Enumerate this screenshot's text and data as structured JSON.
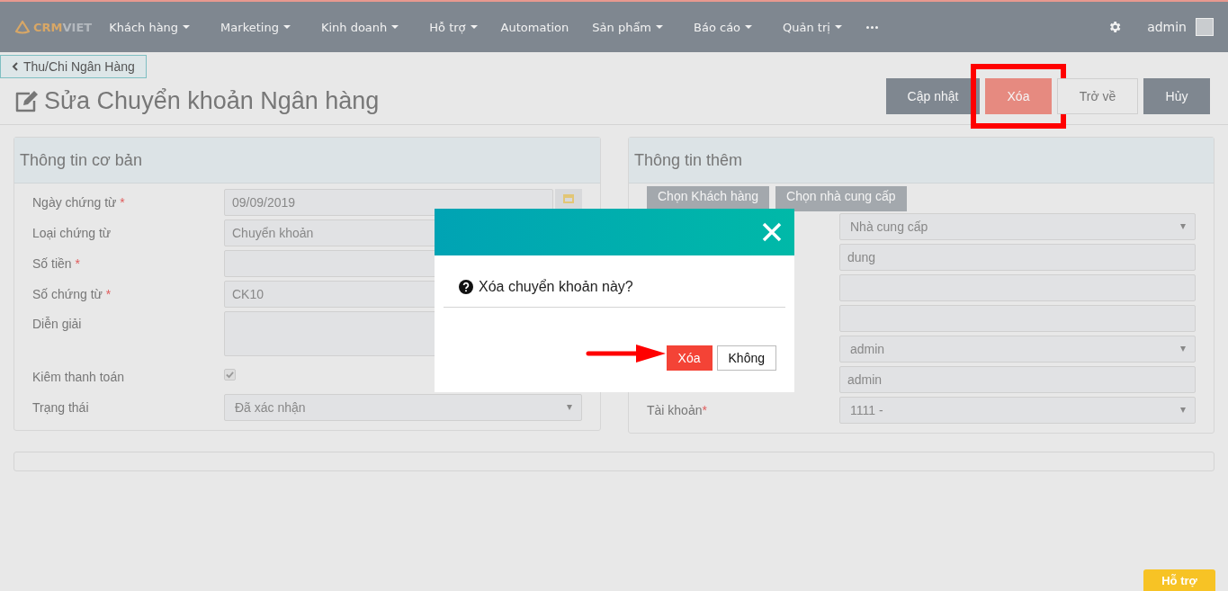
{
  "nav": {
    "logo": [
      "CRM",
      "VIET"
    ],
    "items": [
      {
        "label": "Khách hàng",
        "dropdown": true
      },
      {
        "label": "Marketing",
        "dropdown": true
      },
      {
        "label": "Kinh doanh",
        "dropdown": true
      },
      {
        "label": "Hỗ trợ",
        "dropdown": true
      },
      {
        "label": "Automation",
        "dropdown": false
      },
      {
        "label": "Sản phẩm",
        "dropdown": true
      },
      {
        "label": "Báo cáo",
        "dropdown": true
      },
      {
        "label": "Quản trị",
        "dropdown": true
      }
    ],
    "user": "admin"
  },
  "breadcrumb": "Thu/Chi Ngân Hàng",
  "title": "Sửa Chuyển khoản Ngân hàng",
  "actions": [
    {
      "label": "Cập nhật",
      "kind": "dark",
      "highlighted": false
    },
    {
      "label": "Xóa",
      "kind": "danger",
      "highlighted": true
    },
    {
      "label": "Trở về",
      "kind": "light",
      "highlighted": false
    },
    {
      "label": "Hủy",
      "kind": "dark",
      "highlighted": false
    }
  ],
  "basic": {
    "title": "Thông tin cơ bản",
    "fields": [
      {
        "label": "Ngày chứng từ",
        "required_mark": "*",
        "kind": "date",
        "value": "09/09/2019"
      },
      {
        "label": "Loại chứng từ",
        "kind": "input",
        "value": "Chuyển khoản"
      },
      {
        "label": "Số tiền",
        "required_mark": "*",
        "kind": "input"
      },
      {
        "label": "Số chứng từ",
        "required_mark": "*",
        "kind": "input",
        "value": "CK10"
      },
      {
        "label": "Diễn giải",
        "kind": "textarea"
      },
      {
        "label": "Kiêm thanh toán",
        "kind": "checkbox",
        "checked": true
      },
      {
        "label": "Trạng thái",
        "kind": "select",
        "value": "Đã xác nhận"
      }
    ]
  },
  "extra": {
    "title": "Thông tin thêm",
    "buttons": [
      "Chọn Khách hàng",
      "Chọn nhà cung cấp"
    ],
    "fields": [
      {
        "kind": "select",
        "value": "Nhà cung cấp"
      },
      {
        "kind": "input",
        "value": "dung"
      },
      {
        "kind": "input"
      },
      {
        "kind": "input"
      },
      {
        "kind": "select",
        "value": "admin"
      },
      {
        "kind": "input",
        "value": "admin"
      },
      {
        "label": "Tài khoản",
        "required_mark": "*",
        "kind": "select",
        "value": "1111 -"
      }
    ]
  },
  "dialog": {
    "message": "Xóa chuyển khoản này?",
    "buttons": [
      {
        "label": "Xóa",
        "kind": "danger"
      },
      {
        "label": "Không",
        "kind": "plain"
      }
    ]
  },
  "help_button": "Hỗ trợ"
}
